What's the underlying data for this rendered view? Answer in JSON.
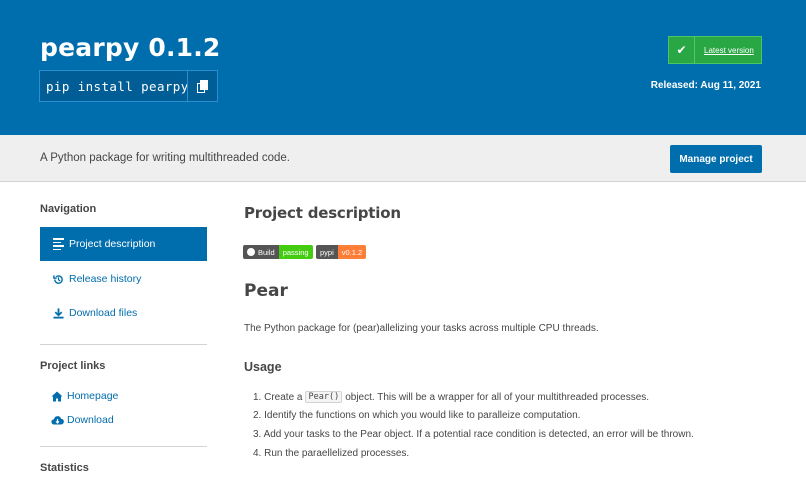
{
  "header": {
    "title": "pearpy 0.1.2",
    "pip_command": "pip install pearpy",
    "latest_label": "Latest version",
    "released": "Released: Aug 11, 2021"
  },
  "strip": {
    "summary": "A Python package for writing multithreaded code.",
    "manage_label": "Manage project"
  },
  "sidebar": {
    "nav_heading": "Navigation",
    "nav_items": [
      {
        "label": "Project description",
        "icon": "lines-icon"
      },
      {
        "label": "Release history",
        "icon": "history-icon"
      },
      {
        "label": "Download files",
        "icon": "download-icon"
      }
    ],
    "links_heading": "Project links",
    "links": [
      {
        "label": "Homepage",
        "icon": "home-icon"
      },
      {
        "label": "Download",
        "icon": "cloud-download-icon"
      }
    ],
    "stats_heading": "Statistics"
  },
  "main": {
    "heading": "Project description",
    "badges": [
      {
        "left": "Build",
        "right": "passing"
      },
      {
        "left": "pypi",
        "right": "v0.1.2"
      }
    ],
    "title": "Pear",
    "intro": "The Python package for (pear)allelizing your tasks across multiple CPU threads.",
    "usage_heading": "Usage",
    "steps": [
      {
        "before": "1. Create a",
        "code": "Pear()",
        "after": "object. This will be a wrapper for all of your multithreaded processes."
      },
      {
        "before": "2. Identify the functions on which you would like to paralleize computation.",
        "code": "",
        "after": ""
      },
      {
        "before": "3. Add your tasks to the Pear object. If a potential race condition is detected, an error will be thrown.",
        "code": "",
        "after": ""
      },
      {
        "before": "4. Run the paraellelized processes.",
        "code": "",
        "after": ""
      }
    ]
  },
  "colors": {
    "brand": "#006dad",
    "success": "#2aa745",
    "badge_dark": "#555555",
    "badge_orange": "#fe7d37",
    "badge_green": "#44cc11"
  }
}
